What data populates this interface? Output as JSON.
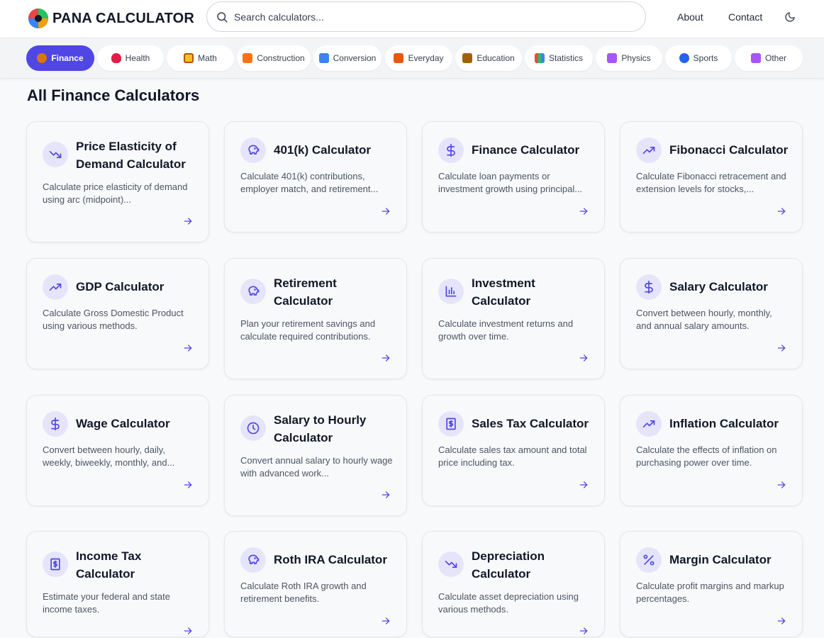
{
  "header": {
    "brand": "PANA CALCULATOR",
    "search_placeholder": "Search calculators...",
    "nav": {
      "about": "About",
      "contact": "Contact"
    }
  },
  "categories": [
    {
      "label": "Finance",
      "icon": "money-bag-icon",
      "active": true
    },
    {
      "label": "Health",
      "icon": "heart-icon"
    },
    {
      "label": "Math",
      "icon": "abacus-icon"
    },
    {
      "label": "Construction",
      "icon": "crane-icon"
    },
    {
      "label": "Conversion",
      "icon": "refresh-icon"
    },
    {
      "label": "Everyday",
      "icon": "house-icon"
    },
    {
      "label": "Education",
      "icon": "box-icon"
    },
    {
      "label": "Statistics",
      "icon": "bar-chart-icon"
    },
    {
      "label": "Physics",
      "icon": "atom-icon"
    },
    {
      "label": "Sports",
      "icon": "ball-icon"
    },
    {
      "label": "Other",
      "icon": "atom-icon"
    }
  ],
  "section_title": "All Finance Calculators",
  "cards": [
    {
      "title": "Price Elasticity of Demand Calculator",
      "desc": "Calculate price elasticity of demand using arc (midpoint)...",
      "icon": "trending-down-icon"
    },
    {
      "title": "401(k) Calculator",
      "desc": "Calculate 401(k) contributions, employer match, and retirement...",
      "icon": "piggy-bank-icon"
    },
    {
      "title": "Finance Calculator",
      "desc": "Calculate loan payments or investment growth using principal...",
      "icon": "dollar-icon"
    },
    {
      "title": "Fibonacci Calculator",
      "desc": "Calculate Fibonacci retracement and extension levels for stocks,...",
      "icon": "trending-up-icon"
    },
    {
      "title": "GDP Calculator",
      "desc": "Calculate Gross Domestic Product using various methods.",
      "icon": "trending-up-icon"
    },
    {
      "title": "Retirement Calculator",
      "desc": "Plan your retirement savings and calculate required contributions.",
      "icon": "piggy-bank-icon"
    },
    {
      "title": "Investment Calculator",
      "desc": "Calculate investment returns and growth over time.",
      "icon": "bar-chart-icon"
    },
    {
      "title": "Salary Calculator",
      "desc": "Convert between hourly, monthly, and annual salary amounts.",
      "icon": "dollar-icon"
    },
    {
      "title": "Wage Calculator",
      "desc": "Convert between hourly, daily, weekly, biweekly, monthly, and...",
      "icon": "dollar-icon"
    },
    {
      "title": "Salary to Hourly Calculator",
      "desc": "Convert annual salary to hourly wage with advanced work...",
      "icon": "clock-icon"
    },
    {
      "title": "Sales Tax Calculator",
      "desc": "Calculate sales tax amount and total price including tax.",
      "icon": "receipt-icon"
    },
    {
      "title": "Inflation Calculator",
      "desc": "Calculate the effects of inflation on purchasing power over time.",
      "icon": "trending-up-icon"
    },
    {
      "title": "Income Tax Calculator",
      "desc": "Estimate your federal and state income taxes.",
      "icon": "receipt-icon"
    },
    {
      "title": "Roth IRA Calculator",
      "desc": "Calculate Roth IRA growth and retirement benefits.",
      "icon": "piggy-bank-icon"
    },
    {
      "title": "Depreciation Calculator",
      "desc": "Calculate asset depreciation using various methods.",
      "icon": "trending-down-icon"
    },
    {
      "title": "Margin Calculator",
      "desc": "Calculate profit margins and markup percentages.",
      "icon": "percent-icon"
    }
  ],
  "colors": {
    "accent": "#4f46e5",
    "icon_bg": "#e6e4fb",
    "icon_fg": "#4f46e5"
  }
}
